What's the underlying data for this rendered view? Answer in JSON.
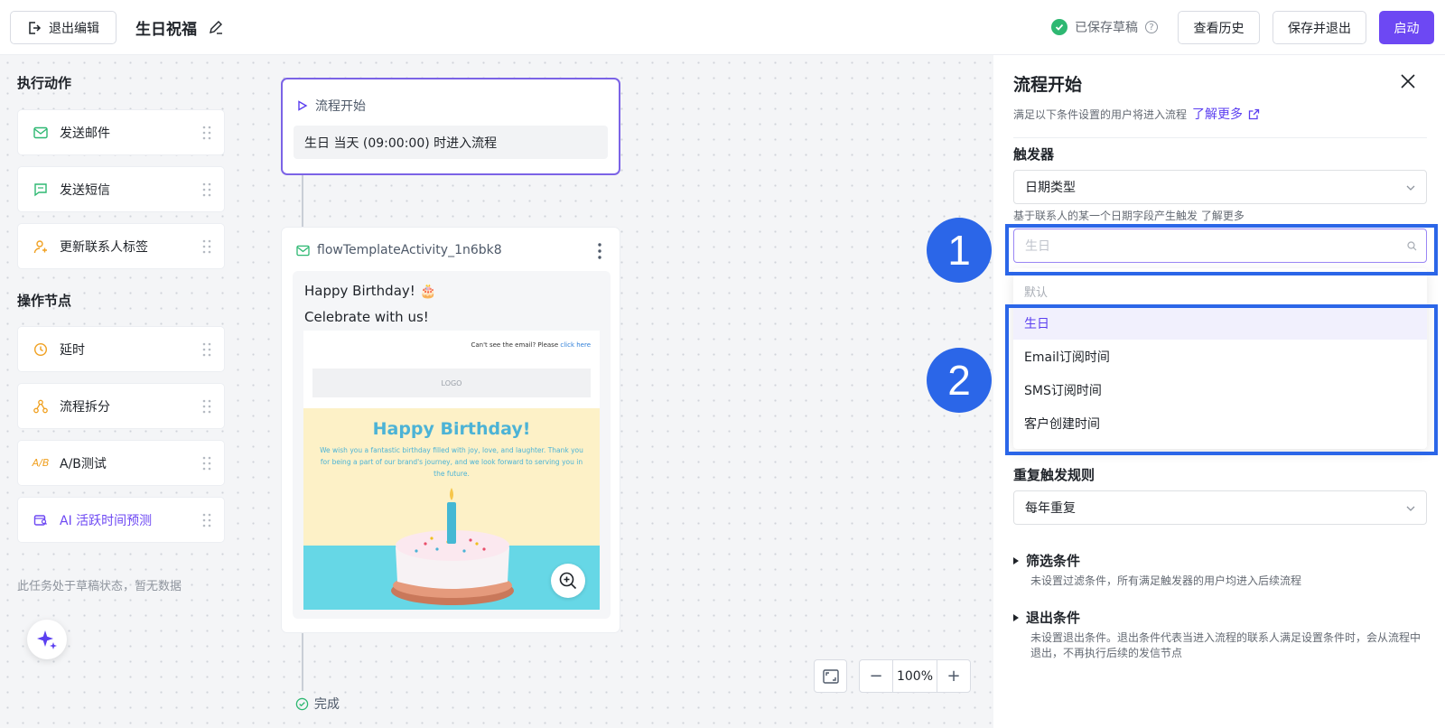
{
  "topbar": {
    "exit_label": "退出编辑",
    "title": "生日祝福",
    "saved_status": "已保存草稿",
    "help_symbol": "?",
    "history_label": "查看历史",
    "save_exit_label": "保存并退出",
    "launch_label": "启动",
    "accent_color": "#6d48f3"
  },
  "sidebar": {
    "actions_title": "执行动作",
    "actions": [
      {
        "label": "发送邮件",
        "icon": "mail-icon"
      },
      {
        "label": "发送短信",
        "icon": "message-icon"
      },
      {
        "label": "更新联系人标签",
        "icon": "user-tag-icon"
      }
    ],
    "nodes_title": "操作节点",
    "nodes": [
      {
        "label": "延时",
        "icon": "clock-icon"
      },
      {
        "label": "流程拆分",
        "icon": "split-icon"
      },
      {
        "label": "A/B测试",
        "icon": "ab-test-icon",
        "icon_text": "A/B"
      },
      {
        "label": "AI 活跃时间预测",
        "icon": "ai-predict-icon"
      }
    ],
    "draft_note": "此任务处于草稿状态，暂无数据"
  },
  "flow": {
    "start_title": "流程开始",
    "start_body": "生日 当天 (09:00:00) 时进入流程",
    "email_node_name": "flowTemplateActivity_1n6bk8",
    "email_subject": "Happy Birthday! 🎂",
    "email_preview": "Celebrate with us!",
    "email_template": {
      "cant_see": "Can't see the email? Please",
      "click_here": "click here",
      "logo": "LOGO",
      "headline": "Happy Birthday!",
      "body": "We wish you a fantastic birthday filled with joy, love, and laughter. Thank you for being a part of our brand's journey, and we look forward to serving you in the future."
    },
    "done_label": "完成"
  },
  "zoom": {
    "minus": "−",
    "value": "100%",
    "plus": "+"
  },
  "panel": {
    "title": "流程开始",
    "subtitle": "满足以下条件设置的用户将进入流程",
    "learn_more": "了解更多",
    "trigger_label": "触发器",
    "trigger_value": "日期类型",
    "trigger_hint": "基于联系人的某一个日期字段产生触发 了解更多",
    "search_placeholder": "生日",
    "dropdown_group": "默认",
    "dropdown_options": [
      "生日",
      "Email订阅时间",
      "SMS订阅时间",
      "客户创建时间"
    ],
    "selected_option": "生日",
    "repeat_label": "重复触发规则",
    "repeat_value": "每年重复",
    "filter_title": "筛选条件",
    "filter_desc": "未设置过滤条件，所有满足触发器的用户均进入后续流程",
    "exit_title": "退出条件",
    "exit_desc": "未设置退出条件。退出条件代表当进入流程的联系人满足设置条件时，会从流程中退出，不再执行后续的发信节点"
  },
  "annotations": {
    "badge_1": "1",
    "badge_2": "2",
    "color": "#2b66e8"
  }
}
